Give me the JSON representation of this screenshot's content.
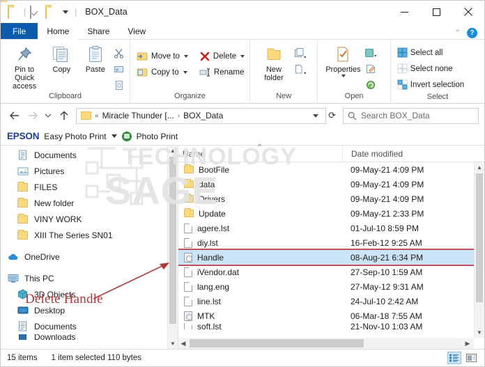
{
  "window": {
    "title": "BOX_Data",
    "quick_access": [
      "folder-icon",
      "properties-icon",
      "new-folder-icon"
    ],
    "minimize_label": "Minimize",
    "maximize_label": "Maximize",
    "close_label": "Close"
  },
  "ribbon": {
    "tabs": [
      {
        "label": "File",
        "active": false,
        "is_file": true
      },
      {
        "label": "Home",
        "active": true,
        "is_file": false
      },
      {
        "label": "Share",
        "active": false,
        "is_file": false
      },
      {
        "label": "View",
        "active": false,
        "is_file": false
      }
    ],
    "collapse_icon": "chevron-up-icon",
    "help_icon": "help-icon",
    "help_glyph": "?",
    "groups": [
      {
        "name": "Clipboard",
        "label": "Clipboard",
        "big_buttons": [
          {
            "label": "Pin to Quick\naccess",
            "line1": "Pin to Quick",
            "line2": "access",
            "icon": "pin-icon"
          },
          {
            "label": "Copy",
            "icon": "copy-icon"
          },
          {
            "label": "Paste",
            "icon": "paste-icon"
          }
        ],
        "mini_icons": [
          "cut-icon",
          "copy-path-icon",
          "paste-shortcut-icon"
        ]
      },
      {
        "name": "Organize",
        "label": "Organize",
        "small_buttons": [
          {
            "label": "Move to",
            "icon": "move-to-icon",
            "has_caret": true
          },
          {
            "label": "Copy to",
            "icon": "copy-to-icon",
            "has_caret": true
          },
          {
            "label": "Delete",
            "icon": "delete-icon",
            "has_caret": true
          },
          {
            "label": "Rename",
            "icon": "rename-icon",
            "has_caret": false
          }
        ]
      },
      {
        "name": "New",
        "label": "New",
        "big_buttons": [
          {
            "label": "New\nfolder",
            "line1": "New",
            "line2": "folder",
            "icon": "new-folder-icon"
          }
        ],
        "mini_icons": [
          "new-item-icon",
          "easy-access-icon"
        ]
      },
      {
        "name": "Open",
        "label": "Open",
        "big_buttons": [
          {
            "label": "Properties",
            "line1": "Properties",
            "line2": "",
            "icon": "properties-icon",
            "has_caret": true
          }
        ],
        "mini_icons": [
          "open-icon",
          "edit-icon",
          "history-icon"
        ]
      },
      {
        "name": "Select",
        "label": "Select",
        "small_buttons": [
          {
            "label": "Select all",
            "icon": "select-all-icon",
            "has_caret": false
          },
          {
            "label": "Select none",
            "icon": "select-none-icon",
            "has_caret": false
          },
          {
            "label": "Invert selection",
            "icon": "invert-selection-icon",
            "has_caret": false
          }
        ]
      }
    ]
  },
  "addressbar": {
    "back_icon": "back-arrow-icon",
    "forward_icon": "forward-arrow-icon",
    "recent_icon": "chevron-down-icon",
    "up_icon": "up-arrow-icon",
    "breadcrumb": [
      {
        "label": "«",
        "type": "overflow"
      },
      {
        "label": "Miracle Thunder [...",
        "type": "crumb"
      },
      {
        "label": "BOX_Data",
        "type": "crumb"
      }
    ],
    "breadcrumb_sep": "›",
    "dropdown_icon": "chevron-down-icon",
    "refresh_icon": "refresh-icon",
    "refresh_glyph": "⟳",
    "search": {
      "placeholder": "Search BOX_Data",
      "value": "",
      "icon": "search-icon"
    }
  },
  "epson_toolbar": {
    "logo": "EPSON",
    "menu_label": "Easy Photo Print",
    "caret_icon": "chevron-down-icon",
    "button_label": "Photo Print",
    "button_icon": "photo-print-icon"
  },
  "watermark": {
    "line1": "TECHNOLOGY",
    "line2": "SAGE"
  },
  "sidebar": {
    "items": [
      {
        "label": "Documents",
        "icon": "documents-icon",
        "indent": "child"
      },
      {
        "label": "Pictures",
        "icon": "pictures-icon",
        "indent": "child"
      },
      {
        "label": "FILES",
        "icon": "folder-icon",
        "indent": "child"
      },
      {
        "label": "New folder",
        "icon": "folder-icon",
        "indent": "child"
      },
      {
        "label": "VINY WORK",
        "icon": "folder-icon",
        "indent": "child"
      },
      {
        "label": "XIII The Series SN01",
        "icon": "folder-icon",
        "indent": "child"
      },
      {
        "label": "OneDrive",
        "icon": "onedrive-icon",
        "indent": "root"
      },
      {
        "label": "This PC",
        "icon": "this-pc-icon",
        "indent": "root"
      },
      {
        "label": "3D Objects",
        "icon": "3d-objects-icon",
        "indent": "child"
      },
      {
        "label": "Desktop",
        "icon": "desktop-icon",
        "indent": "child"
      },
      {
        "label": "Documents",
        "icon": "documents-icon",
        "indent": "child"
      },
      {
        "label": "Downloads",
        "icon": "downloads-icon",
        "indent": "child"
      }
    ],
    "scroll_up_icon": "scroll-up-arrow-icon",
    "scroll_down_icon": "scroll-down-arrow-icon"
  },
  "annotation": {
    "text": "Delete Handle",
    "color": "#b03a3a",
    "arrow_icon": "annotation-arrow-icon"
  },
  "filelist": {
    "columns": [
      {
        "label": "Name",
        "sorted": true,
        "sort_icon": "sort-ascending-icon"
      },
      {
        "label": "Date modified",
        "sorted": false
      }
    ],
    "rows": [
      {
        "name": "BootFile",
        "date": "09-May-21 4:09 PM",
        "icon": "folder-icon",
        "selected": false
      },
      {
        "name": "data",
        "date": "09-May-21 4:09 PM",
        "icon": "folder-icon",
        "selected": false
      },
      {
        "name": "Drivers",
        "date": "09-May-21 4:09 PM",
        "icon": "folder-icon-dim",
        "selected": false
      },
      {
        "name": "Update",
        "date": "09-May-21 2:33 PM",
        "icon": "folder-icon",
        "selected": false
      },
      {
        "name": "agere.lst",
        "date": "01-Jul-10 8:59 PM",
        "icon": "file-icon",
        "selected": false
      },
      {
        "name": "diy.lst",
        "date": "16-Feb-12 9:25 AM",
        "icon": "file-icon",
        "selected": false
      },
      {
        "name": "Handle",
        "date": "08-Aug-21 6:34 PM",
        "icon": "exe-icon",
        "selected": true
      },
      {
        "name": "iVendor.dat",
        "date": "27-Sep-10 1:59 AM",
        "icon": "file-icon",
        "selected": false
      },
      {
        "name": "lang.eng",
        "date": "27-May-12 9:31 AM",
        "icon": "file-icon",
        "selected": false
      },
      {
        "name": "line.lst",
        "date": "24-Jul-10 2:42 AM",
        "icon": "file-icon",
        "selected": false
      },
      {
        "name": "MTK",
        "date": "06-Mar-18 7:55 AM",
        "icon": "exe-icon",
        "selected": false
      },
      {
        "name": "soft.lst",
        "date": "21-Nov-10 1:03 AM",
        "icon": "file-icon",
        "selected": false
      }
    ],
    "selection_outline_color": "#c14f5e",
    "selection_fill_color": "#cce4f7"
  },
  "statusbar": {
    "item_count": "15 items",
    "selection_info": "1 item selected  110 bytes",
    "views": [
      {
        "name": "details-view-button",
        "active": true
      },
      {
        "name": "large-icons-view-button",
        "active": false
      }
    ]
  }
}
